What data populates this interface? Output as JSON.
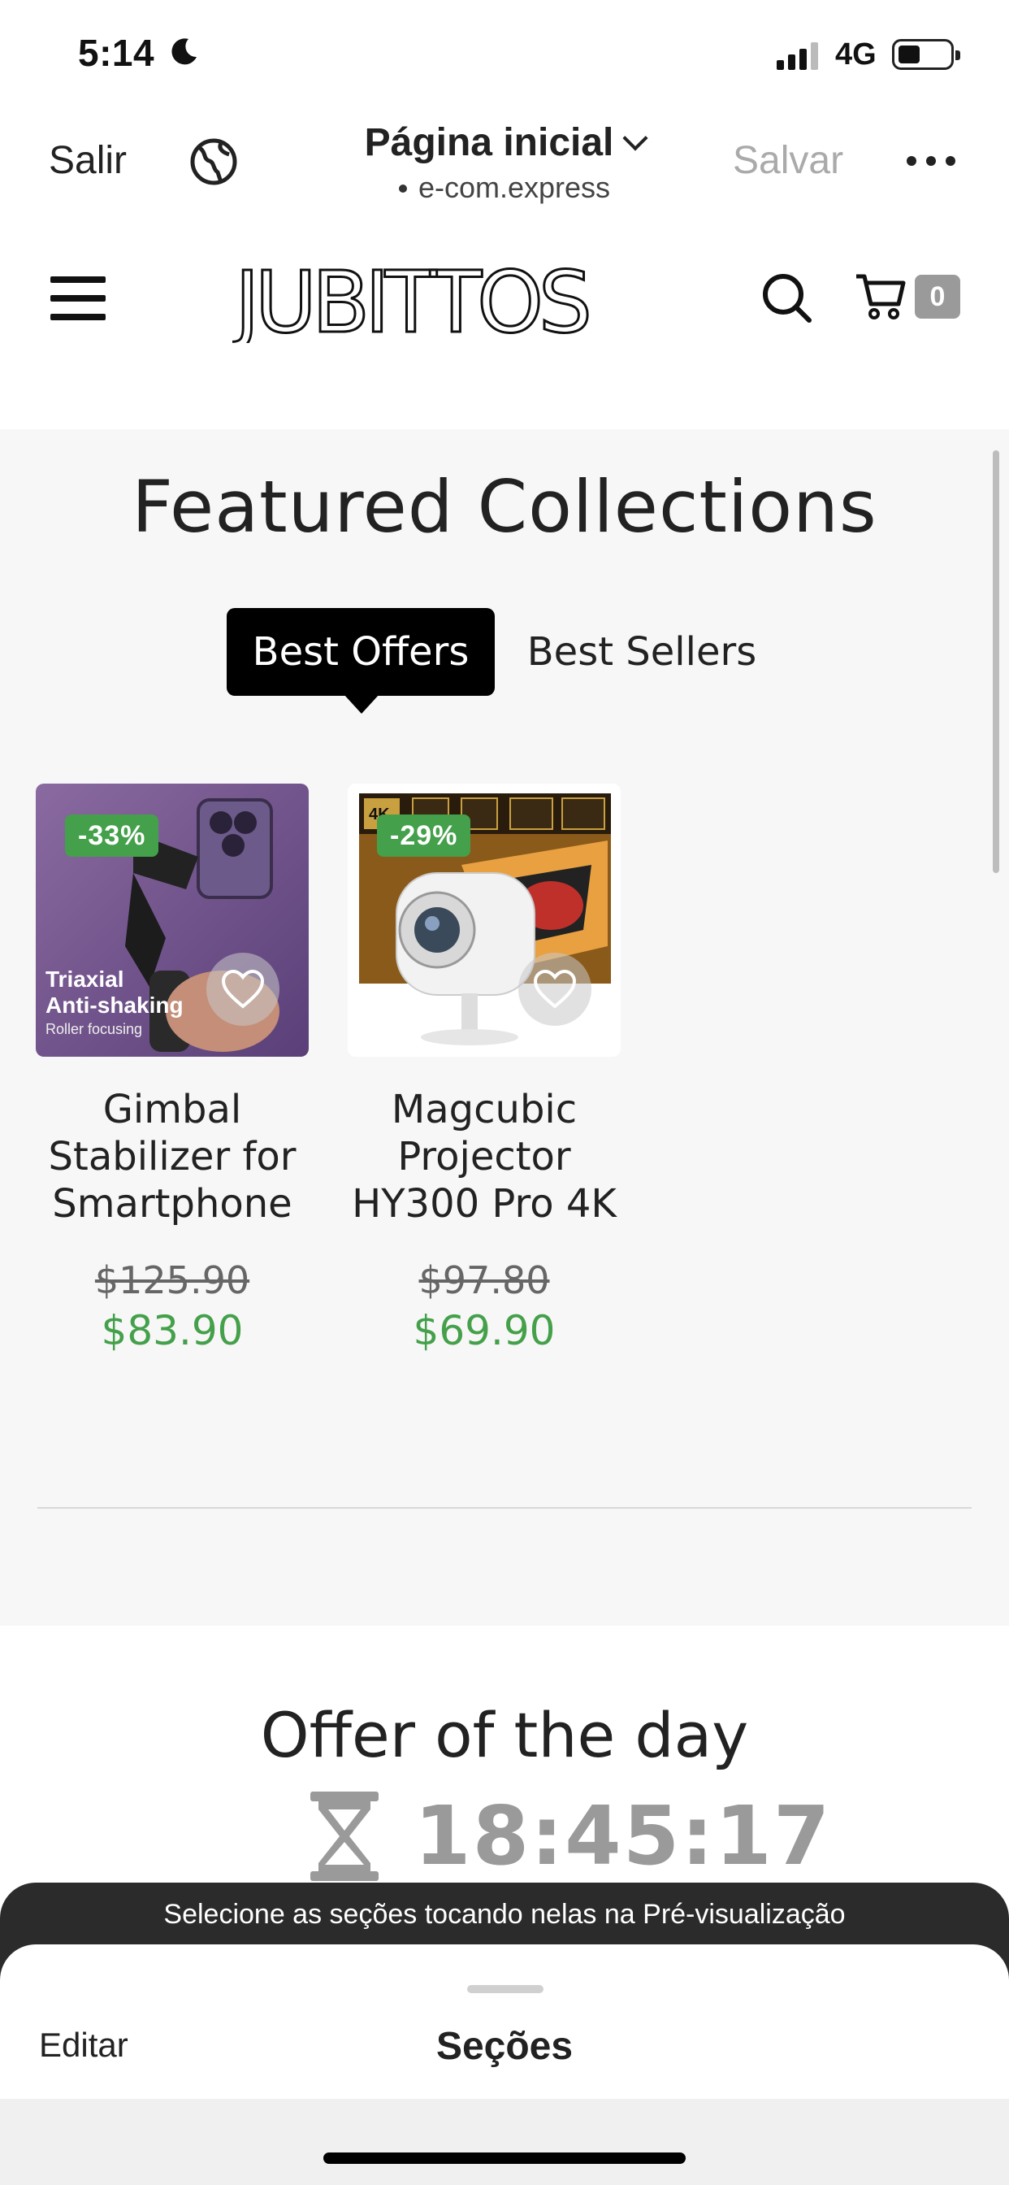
{
  "status_bar": {
    "time": "5:14",
    "network": "4G"
  },
  "editor": {
    "exit_label": "Salir",
    "page_name": "Página inicial",
    "domain": "e-com.express",
    "save_label": "Salvar"
  },
  "store": {
    "logo_text": "JUBITTOS",
    "cart_count": "0"
  },
  "featured": {
    "title": "Featured Collections",
    "tabs": [
      {
        "label": "Best Offers",
        "active": true
      },
      {
        "label": "Best Sellers",
        "active": false
      }
    ],
    "products": [
      {
        "name": "Gimbal Stabilizer for Smartphone",
        "badge": "-33%",
        "price_old": "$125.90",
        "price_new": "$83.90",
        "image_caption_1": "Triaxial",
        "image_caption_2": "Anti-shaking",
        "image_caption_3": "Roller focusing"
      },
      {
        "name": "Magcubic Projector HY300 Pro 4K",
        "badge": "-29%",
        "price_old": "$97.80",
        "price_new": "$69.90",
        "image_caption_1": "4K"
      }
    ]
  },
  "offer": {
    "title": "Offer of the day",
    "countdown": "18:45:17"
  },
  "sheet": {
    "hint": "Selecione as seções tocando nelas na Pré-visualização",
    "edit_label": "Editar",
    "title": "Seções"
  },
  "colors": {
    "accent_green": "#44a04a",
    "badge_gray": "#9a9a9a",
    "dark": "#2b2b2b"
  }
}
